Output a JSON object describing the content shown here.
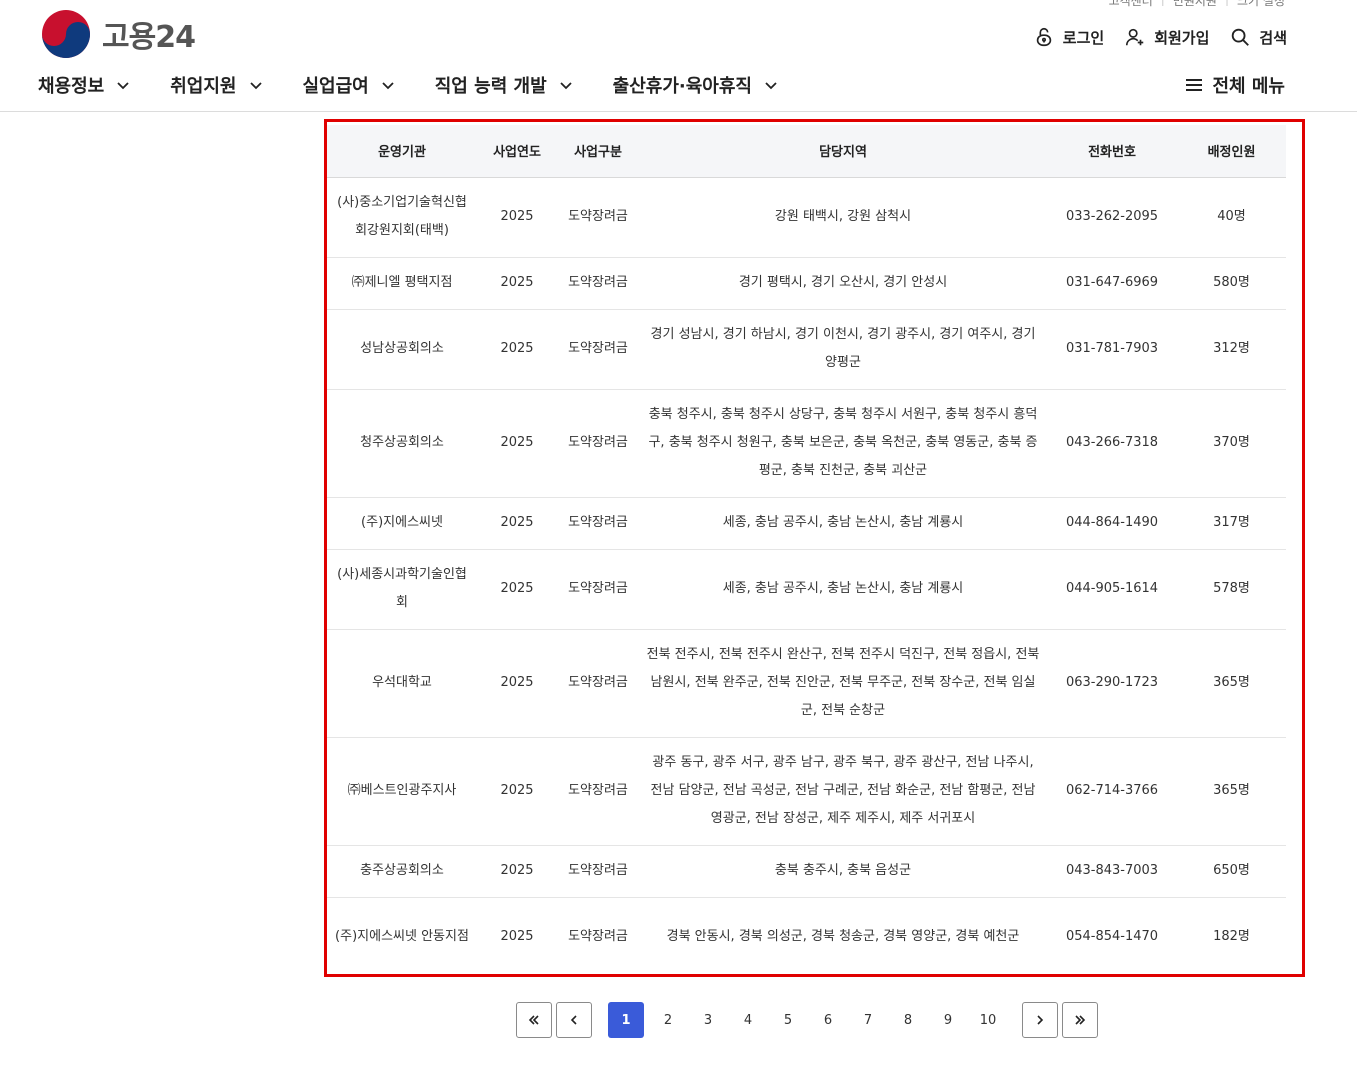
{
  "header": {
    "logo_text": "고용24",
    "top_links": [
      "고객센터",
      "민원지원",
      "크기 설정"
    ],
    "login": "로그인",
    "signup": "회원가입",
    "search": "검색",
    "nav": [
      "채용정보",
      "취업지원",
      "실업급여",
      "직업 능력 개발",
      "출산휴가·육아휴직"
    ],
    "all_menu": "전체 메뉴"
  },
  "table": {
    "headers": [
      "운영기관",
      "사업연도",
      "사업구분",
      "담당지역",
      "전화번호",
      "배정인원"
    ],
    "rows": [
      {
        "org": "(사)중소기업기술혁신협회강원지회(태백)",
        "year": "2025",
        "type": "도약장려금",
        "area": "강원 태백시, 강원 삼척시",
        "phone": "033-262-2095",
        "count": "40명"
      },
      {
        "org": "㈜제니엘 평택지점",
        "year": "2025",
        "type": "도약장려금",
        "area": "경기 평택시, 경기 오산시, 경기 안성시",
        "phone": "031-647-6969",
        "count": "580명"
      },
      {
        "org": "성남상공회의소",
        "year": "2025",
        "type": "도약장려금",
        "area": "경기 성남시, 경기 하남시, 경기 이천시, 경기 광주시, 경기 여주시, 경기 양평군",
        "phone": "031-781-7903",
        "count": "312명"
      },
      {
        "org": "청주상공회의소",
        "year": "2025",
        "type": "도약장려금",
        "area": "충북 청주시, 충북 청주시 상당구, 충북 청주시 서원구, 충북 청주시 흥덕구, 충북 청주시 청원구, 충북 보은군, 충북 옥천군, 충북 영동군, 충북 증평군, 충북 진천군, 충북 괴산군",
        "phone": "043-266-7318",
        "count": "370명"
      },
      {
        "org": "(주)지에스씨넷",
        "year": "2025",
        "type": "도약장려금",
        "area": "세종, 충남 공주시, 충남 논산시, 충남 계룡시",
        "phone": "044-864-1490",
        "count": "317명"
      },
      {
        "org": "(사)세종시과학기술인협회",
        "year": "2025",
        "type": "도약장려금",
        "area": "세종, 충남 공주시, 충남 논산시, 충남 계룡시",
        "phone": "044-905-1614",
        "count": "578명"
      },
      {
        "org": "우석대학교",
        "year": "2025",
        "type": "도약장려금",
        "area": "전북 전주시, 전북 전주시 완산구, 전북 전주시 덕진구, 전북 정읍시, 전북 남원시, 전북 완주군, 전북 진안군, 전북 무주군, 전북 장수군, 전북 임실군, 전북 순창군",
        "phone": "063-290-1723",
        "count": "365명"
      },
      {
        "org": "㈜베스트인광주지사",
        "year": "2025",
        "type": "도약장려금",
        "area": "광주 동구, 광주 서구, 광주 남구, 광주 북구, 광주 광산구, 전남 나주시, 전남 담양군, 전남 곡성군, 전남 구례군, 전남 화순군, 전남 함평군, 전남 영광군, 전남 장성군, 제주 제주시, 제주 서귀포시",
        "phone": "062-714-3766",
        "count": "365명"
      },
      {
        "org": "충주상공회의소",
        "year": "2025",
        "type": "도약장려금",
        "area": "충북 충주시, 충북 음성군",
        "phone": "043-843-7003",
        "count": "650명"
      },
      {
        "org": "(주)지에스씨넷 안동지점",
        "year": "2025",
        "type": "도약장려금",
        "area": "경북 안동시, 경북 의성군, 경북 청송군, 경북 영양군, 경북 예천군",
        "phone": "054-854-1470",
        "count": "182명"
      }
    ]
  },
  "pagination": {
    "pages": [
      "1",
      "2",
      "3",
      "4",
      "5",
      "6",
      "7",
      "8",
      "9",
      "10"
    ],
    "current": "1"
  },
  "colors": {
    "highlight_border": "#e00000",
    "active_page": "#3a5bd9",
    "header_bg": "#f5f6f8"
  }
}
